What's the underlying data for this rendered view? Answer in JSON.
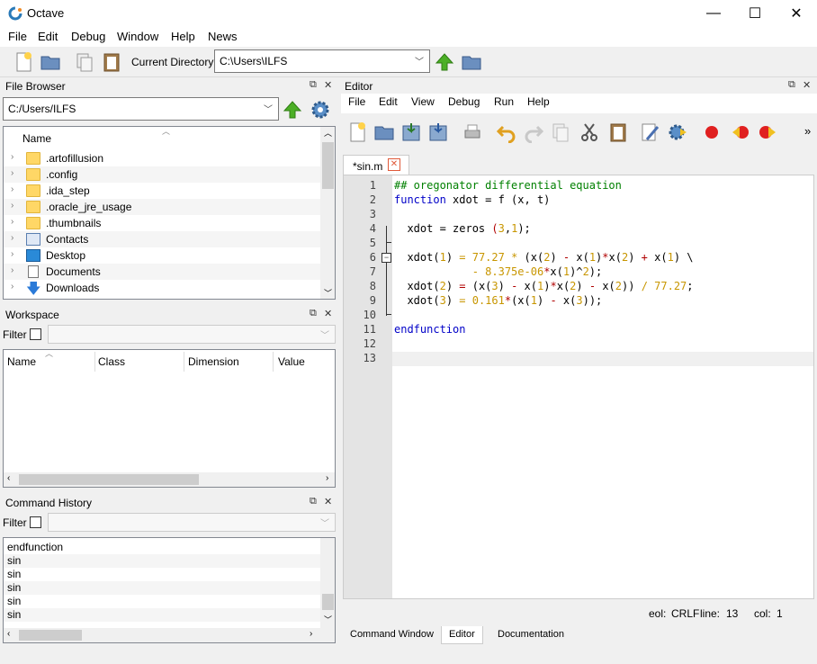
{
  "window": {
    "title": "Octave",
    "minimize": "—",
    "maximize": "☐",
    "close": "✕"
  },
  "menu": [
    "File",
    "Edit",
    "Debug",
    "Window",
    "Help",
    "News"
  ],
  "toolbar": {
    "current_dir_label": "Current Directory:",
    "current_dir_value": "C:\\Users\\ILFS"
  },
  "file_browser": {
    "title": "File Browser",
    "path": "C:/Users/ILFS",
    "column": "Name",
    "items": [
      {
        "label": ".artofillusion",
        "icon": "folder-icon"
      },
      {
        "label": ".config",
        "icon": "folder-icon"
      },
      {
        "label": ".ida_step",
        "icon": "folder-icon"
      },
      {
        "label": ".oracle_jre_usage",
        "icon": "folder-icon"
      },
      {
        "label": ".thumbnails",
        "icon": "folder-icon"
      },
      {
        "label": "Contacts",
        "icon": "contacts-icon"
      },
      {
        "label": "Desktop",
        "icon": "desktop-icon"
      },
      {
        "label": "Documents",
        "icon": "documents-icon"
      },
      {
        "label": "Downloads",
        "icon": "downloads-icon"
      }
    ]
  },
  "workspace": {
    "title": "Workspace",
    "filter_label": "Filter",
    "columns": [
      "Name",
      "Class",
      "Dimension",
      "Value"
    ]
  },
  "history": {
    "title": "Command History",
    "filter_label": "Filter",
    "items": [
      "endfunction",
      "sin",
      "sin",
      "sin",
      "sin",
      "sin"
    ]
  },
  "editor": {
    "title": "Editor",
    "menu": [
      "File",
      "Edit",
      "View",
      "Debug",
      "Run",
      "Help"
    ],
    "tab": "*sin.m",
    "line_numbers": [
      "1",
      "2",
      "3",
      "4",
      "5",
      "6",
      "7",
      "8",
      "9",
      "10",
      "11",
      "12",
      "13"
    ],
    "code_lines": [
      [
        {
          "t": "## oregonator differential equation",
          "c": "comment"
        }
      ],
      [
        {
          "t": "function",
          "c": "kw"
        },
        {
          "t": " xdot = f (x, t)",
          "c": "plain"
        }
      ],
      [],
      [
        {
          "t": "  xdot = zeros ",
          "c": "plain"
        },
        {
          "t": "(",
          "c": "op"
        },
        {
          "t": "3",
          "c": "num"
        },
        {
          "t": ",",
          "c": "plain"
        },
        {
          "t": "1",
          "c": "num"
        },
        {
          "t": ");",
          "c": "plain"
        }
      ],
      [],
      [
        {
          "t": "  xdot(",
          "c": "plain"
        },
        {
          "t": "1",
          "c": "num"
        },
        {
          "t": ") ",
          "c": "plain"
        },
        {
          "t": "= 77.27 * ",
          "c": "num"
        },
        {
          "t": "(x(",
          "c": "plain"
        },
        {
          "t": "2",
          "c": "num"
        },
        {
          "t": ") ",
          "c": "plain"
        },
        {
          "t": "-",
          "c": "op"
        },
        {
          "t": " x(",
          "c": "plain"
        },
        {
          "t": "1",
          "c": "num"
        },
        {
          "t": ")",
          "c": "plain"
        },
        {
          "t": "*",
          "c": "op"
        },
        {
          "t": "x(",
          "c": "plain"
        },
        {
          "t": "2",
          "c": "num"
        },
        {
          "t": ") ",
          "c": "plain"
        },
        {
          "t": "+",
          "c": "op"
        },
        {
          "t": " x(",
          "c": "plain"
        },
        {
          "t": "1",
          "c": "num"
        },
        {
          "t": ") \\",
          "c": "plain"
        }
      ],
      [
        {
          "t": "            ",
          "c": "plain"
        },
        {
          "t": "- 8.375e-06",
          "c": "num"
        },
        {
          "t": "*",
          "c": "op"
        },
        {
          "t": "x(",
          "c": "plain"
        },
        {
          "t": "1",
          "c": "num"
        },
        {
          "t": ")^",
          "c": "plain"
        },
        {
          "t": "2",
          "c": "num"
        },
        {
          "t": ");",
          "c": "plain"
        }
      ],
      [
        {
          "t": "  xdot(",
          "c": "plain"
        },
        {
          "t": "2",
          "c": "num"
        },
        {
          "t": ") ",
          "c": "plain"
        },
        {
          "t": "=",
          "c": "op"
        },
        {
          "t": " (x(",
          "c": "plain"
        },
        {
          "t": "3",
          "c": "num"
        },
        {
          "t": ") ",
          "c": "plain"
        },
        {
          "t": "-",
          "c": "op"
        },
        {
          "t": " x(",
          "c": "plain"
        },
        {
          "t": "1",
          "c": "num"
        },
        {
          "t": ")",
          "c": "plain"
        },
        {
          "t": "*",
          "c": "op"
        },
        {
          "t": "x(",
          "c": "plain"
        },
        {
          "t": "2",
          "c": "num"
        },
        {
          "t": ") ",
          "c": "plain"
        },
        {
          "t": "-",
          "c": "op"
        },
        {
          "t": " x(",
          "c": "plain"
        },
        {
          "t": "2",
          "c": "num"
        },
        {
          "t": ")) ",
          "c": "plain"
        },
        {
          "t": "/ 77.27",
          "c": "num"
        },
        {
          "t": ";",
          "c": "plain"
        }
      ],
      [
        {
          "t": "  xdot(",
          "c": "plain"
        },
        {
          "t": "3",
          "c": "num"
        },
        {
          "t": ") ",
          "c": "plain"
        },
        {
          "t": "= 0.161",
          "c": "num"
        },
        {
          "t": "*",
          "c": "op"
        },
        {
          "t": "(x(",
          "c": "plain"
        },
        {
          "t": "1",
          "c": "num"
        },
        {
          "t": ") ",
          "c": "plain"
        },
        {
          "t": "-",
          "c": "op"
        },
        {
          "t": " x(",
          "c": "plain"
        },
        {
          "t": "3",
          "c": "num"
        },
        {
          "t": "));",
          "c": "plain"
        }
      ],
      [],
      [
        {
          "t": "endfunction",
          "c": "kw"
        }
      ],
      [],
      []
    ],
    "status": {
      "eol_label": "eol:",
      "eol": "CRLF",
      "line_label": "line:",
      "line": "13",
      "col_label": "col:",
      "col": "1"
    }
  },
  "bottom_tabs": [
    "Command Window",
    "Editor",
    "Documentation"
  ],
  "colors": {
    "comment": "#008000",
    "kw": "#0000c8",
    "num": "#c89600",
    "op": "#b00000",
    "plain": "#000000"
  }
}
